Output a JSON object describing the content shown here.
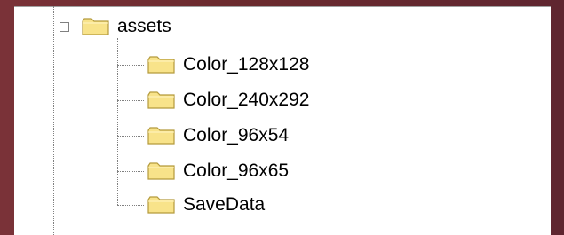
{
  "tree": {
    "root": {
      "label": "assets",
      "icon": "folder-icon",
      "expanded": true
    },
    "children": [
      {
        "label": "Color_128x128",
        "icon": "folder-icon"
      },
      {
        "label": "Color_240x292",
        "icon": "folder-icon"
      },
      {
        "label": "Color_96x54",
        "icon": "folder-icon"
      },
      {
        "label": "Color_96x65",
        "icon": "folder-icon"
      },
      {
        "label": "SaveData",
        "icon": "folder-icon"
      }
    ]
  },
  "colors": {
    "background": "#6b2a2e",
    "panel": "#ffffff",
    "folder_fill": "#f8e38a",
    "folder_outline": "#b49a3c",
    "tree_lines": "#808080"
  }
}
